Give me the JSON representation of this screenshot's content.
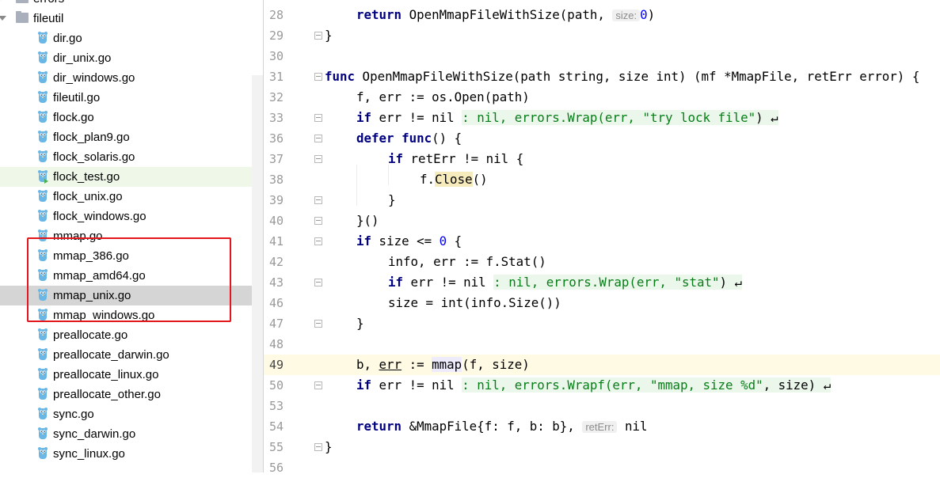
{
  "tree": {
    "items": [
      {
        "label": "errors",
        "kind": "folder",
        "state": "collapsed"
      },
      {
        "label": "fileutil",
        "kind": "folder",
        "state": "expanded"
      },
      {
        "label": "dir.go",
        "kind": "file"
      },
      {
        "label": "dir_unix.go",
        "kind": "file"
      },
      {
        "label": "dir_windows.go",
        "kind": "file"
      },
      {
        "label": "fileutil.go",
        "kind": "file"
      },
      {
        "label": "flock.go",
        "kind": "file"
      },
      {
        "label": "flock_plan9.go",
        "kind": "file"
      },
      {
        "label": "flock_solaris.go",
        "kind": "file"
      },
      {
        "label": "flock_test.go",
        "kind": "test-file"
      },
      {
        "label": "flock_unix.go",
        "kind": "file"
      },
      {
        "label": "flock_windows.go",
        "kind": "file"
      },
      {
        "label": "mmap.go",
        "kind": "file"
      },
      {
        "label": "mmap_386.go",
        "kind": "file"
      },
      {
        "label": "mmap_amd64.go",
        "kind": "file"
      },
      {
        "label": "mmap_unix.go",
        "kind": "file",
        "selected": true
      },
      {
        "label": "mmap_windows.go",
        "kind": "file"
      },
      {
        "label": "preallocate.go",
        "kind": "file"
      },
      {
        "label": "preallocate_darwin.go",
        "kind": "file"
      },
      {
        "label": "preallocate_linux.go",
        "kind": "file"
      },
      {
        "label": "preallocate_other.go",
        "kind": "file"
      },
      {
        "label": "sync.go",
        "kind": "file"
      },
      {
        "label": "sync_darwin.go",
        "kind": "file"
      },
      {
        "label": "sync_linux.go",
        "kind": "file"
      }
    ]
  },
  "editor": {
    "line_numbers": [
      "28",
      "29",
      "30",
      "31",
      "32",
      "33",
      "36",
      "37",
      "38",
      "39",
      "40",
      "41",
      "42",
      "43",
      "46",
      "47",
      "48",
      "49",
      "50",
      "53",
      "54",
      "55",
      "56"
    ],
    "current_line": "49",
    "code": {
      "l28": {
        "kw": "return",
        "text": " OpenMmapFileWithSize(path, ",
        "hint": "size:",
        "num": "0",
        "tail": ")"
      },
      "l29": "}",
      "l31": {
        "kw": "func",
        "text": " OpenMmapFileWithSize(path string, size int) (mf *MmapFile, retErr error) {"
      },
      "l32": "f, err := os.Open(path)",
      "l33": {
        "kw": "if",
        "text": " err != nil ",
        "fold": ": nil, errors.Wrap(err, ",
        "str": "\"try lock file\"",
        "close": ") ↵"
      },
      "l36": {
        "kw": "defer",
        "kw2": "func",
        "text": "() {"
      },
      "l37": {
        "kw": "if",
        "text": " retErr != nil {"
      },
      "l38": {
        "pre": "f.",
        "method": "Close",
        "post": "()"
      },
      "l39": "}",
      "l40": "}()",
      "l41": {
        "kw": "if",
        "text": " size <= ",
        "num": "0",
        "tail": " {"
      },
      "l42": "info, err := f.Stat()",
      "l43": {
        "kw": "if",
        "text": " err != nil ",
        "fold": ": nil, errors.Wrap(err, ",
        "str": "\"stat\"",
        "close": ") ↵"
      },
      "l46": "size = int(info.Size())",
      "l47": "}",
      "l49": {
        "pre": "b, ",
        "err": "err",
        "mid": " := ",
        "call": "mmap",
        "post": "(f, size)"
      },
      "l50": {
        "kw": "if",
        "text": " err != nil ",
        "fold": ": nil, errors.Wrapf(err, ",
        "str": "\"mmap, size %d\"",
        "close": ", size) ↵"
      },
      "l54": {
        "kw": "return",
        "text": " &MmapFile{f: f, b: b}, ",
        "hint": "retErr:",
        "tail": "nil"
      },
      "l55": "}"
    }
  },
  "colors": {
    "highlight_box": "#e3161b",
    "keyword": "#000080",
    "number": "#0000ff",
    "string": "#067d17",
    "current_line": "#fffae3"
  }
}
